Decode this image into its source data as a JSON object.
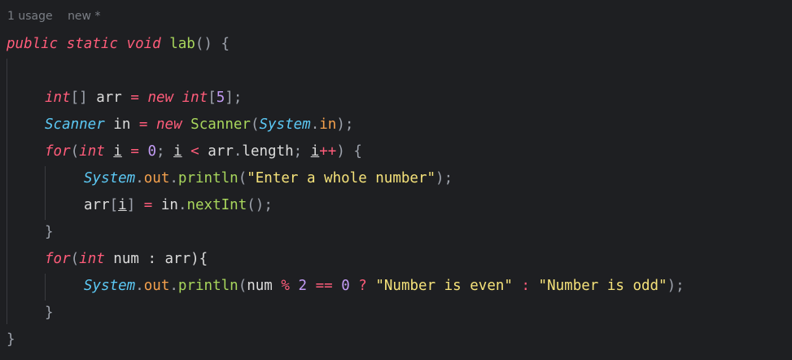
{
  "inlay_hints": {
    "usages": "1 usage",
    "author": "new *"
  },
  "code": {
    "line1": {
      "kw1": "public",
      "kw2": "static",
      "kw3": "void",
      "method": "lab",
      "rest": "() {"
    },
    "line3": {
      "t": "int",
      "br": "[]",
      "name": " arr ",
      "eq": "=",
      "sp": " ",
      "kw": "new",
      "sp2": " ",
      "t2": "int",
      "lb": "[",
      "n": "5",
      "rb": "];"
    },
    "line4": {
      "t": "Scanner",
      "name": " in ",
      "eq": "=",
      "sp": " ",
      "kw": "new",
      "sp2": " ",
      "ctor": "Scanner",
      "lp": "(",
      "cls": "System",
      "dot": ".",
      "fld": "in",
      "rp": ");"
    },
    "line5": {
      "kw": "for",
      "lp": "(",
      "t": "int",
      "sp": " ",
      "v1": "i",
      "eq": " = ",
      "n": "0",
      "semi": "; ",
      "v2": "i",
      "lt": " < ",
      "arr": "arr",
      "dot": ".",
      "len": "length",
      "semi2": "; ",
      "v3": "i",
      "inc": "++",
      "rp": ") {"
    },
    "line6": {
      "cls": "System",
      "dot": ".",
      "fld": "out",
      "dot2": ".",
      "fn": "println",
      "lp": "(",
      "str": "\"Enter a whole number\"",
      "rp": ");"
    },
    "line7": {
      "arr": "arr",
      "lb": "[",
      "v": "i",
      "rb": "]",
      "eq": " = ",
      "obj": "in",
      "dot": ".",
      "fn": "nextInt",
      "rp": "();"
    },
    "line8": {
      "brace": "}"
    },
    "line9": {
      "kw": "for",
      "lp": "(",
      "t": "int",
      "rest": " num : arr){"
    },
    "line10": {
      "cls": "System",
      "dot": ".",
      "fld": "out",
      "dot2": ".",
      "fn": "println",
      "lp": "(",
      "a": "num ",
      "mod": "%",
      "sp": " ",
      "n2": "2",
      "sp2": " ",
      "eqeq": "==",
      "sp3": " ",
      "n0": "0",
      "q": " ? ",
      "s1": "\"Number is even\"",
      "colon": " : ",
      "s2": "\"Number is odd\"",
      "rp": ");"
    },
    "line11": {
      "brace": "}"
    },
    "line12": {
      "brace": "}"
    }
  }
}
